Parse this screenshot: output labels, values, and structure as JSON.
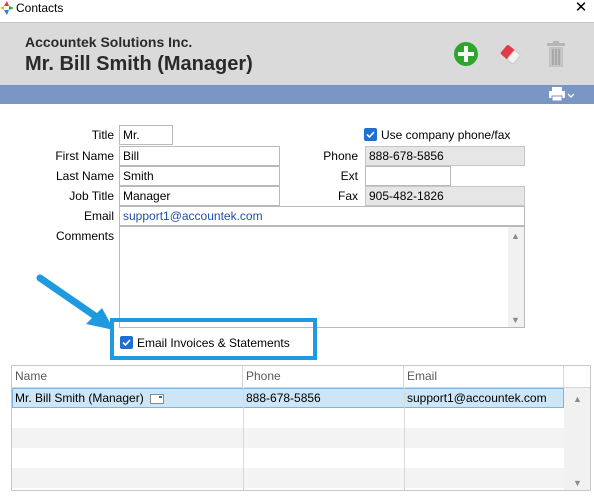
{
  "window": {
    "title": "Contacts",
    "close_label": "✕"
  },
  "header": {
    "company": "Accountek Solutions Inc.",
    "contact_name": "Mr. Bill Smith (Manager)",
    "add_icon": "add-icon",
    "erase_icon": "eraser-icon",
    "delete_icon": "trash-icon",
    "print_icon": "printer-icon"
  },
  "form": {
    "title": {
      "label": "Title",
      "value": "Mr."
    },
    "first_name": {
      "label": "First Name",
      "value": "Bill"
    },
    "last_name": {
      "label": "Last Name",
      "value": "Smith"
    },
    "job_title": {
      "label": "Job Title",
      "value": "Manager"
    },
    "email": {
      "label": "Email",
      "value": "support1@accountek.com"
    },
    "comments": {
      "label": "Comments",
      "value": ""
    },
    "use_company_phone": {
      "label": "Use company phone/fax",
      "checked": true
    },
    "phone": {
      "label": "Phone",
      "value": "888-678-5856"
    },
    "ext": {
      "label": "Ext",
      "value": ""
    },
    "fax": {
      "label": "Fax",
      "value": "905-482-1826"
    },
    "email_invoices": {
      "label": "Email Invoices & Statements",
      "checked": true
    }
  },
  "grid": {
    "columns": [
      "Name",
      "Phone",
      "Email"
    ],
    "rows": [
      {
        "name": "Mr. Bill Smith (Manager)",
        "phone": "888-678-5856",
        "email": "support1@accountek.com",
        "selected": true
      }
    ]
  },
  "colors": {
    "accent_bar": "#7a96c4",
    "checkbox": "#1f6fd1",
    "selected_row": "#cce6f8",
    "annotation": "#1f9ae0",
    "link": "#1f4fb0"
  }
}
